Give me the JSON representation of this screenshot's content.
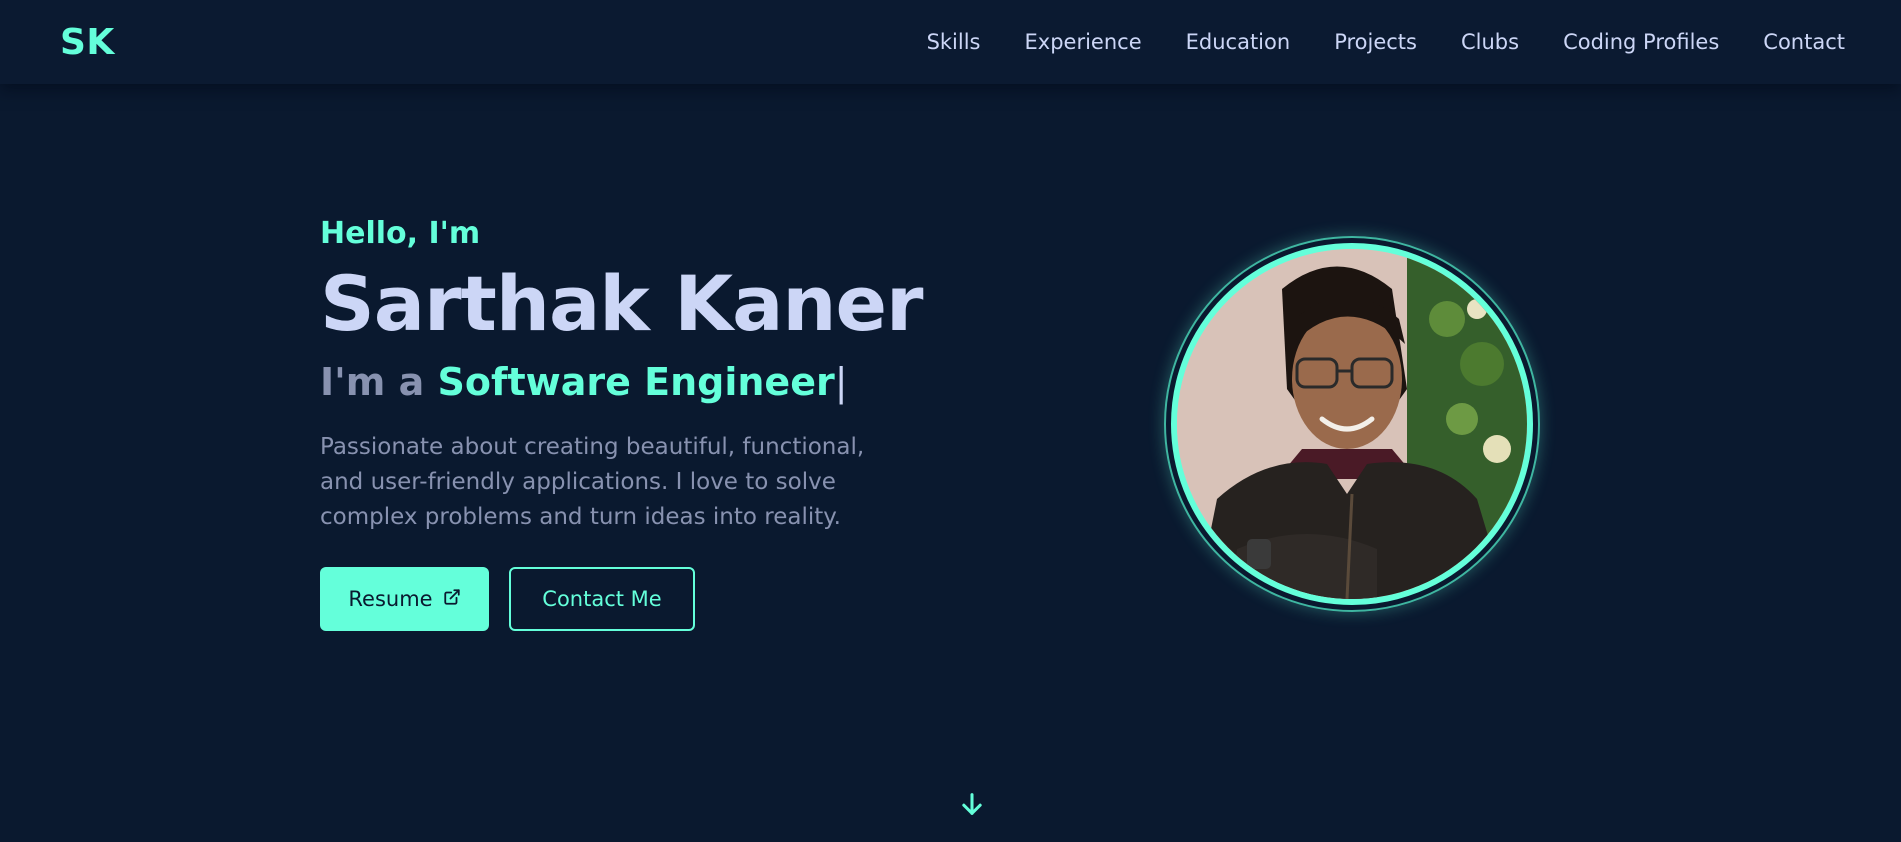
{
  "logo": "SK",
  "nav": {
    "items": [
      "Skills",
      "Experience",
      "Education",
      "Projects",
      "Clubs",
      "Coding Profiles",
      "Contact"
    ]
  },
  "hero": {
    "greeting": "Hello, I'm",
    "name": "Sarthak Kaner",
    "role_prefix": "I'm a",
    "role_title": "Software Engineer",
    "cursor": "|",
    "bio": "Passionate about creating beautiful, functional, and user-friendly applications. I love to solve complex problems and turn ideas into reality.",
    "resume_label": "Resume",
    "contact_label": "Contact Me"
  },
  "icons": {
    "resume": "external-link-icon",
    "scroll": "arrow-down-icon"
  },
  "colors": {
    "background": "#0a192f",
    "accent": "#64ffda",
    "text_primary": "#ccd6f6",
    "text_secondary": "#8892b0"
  }
}
